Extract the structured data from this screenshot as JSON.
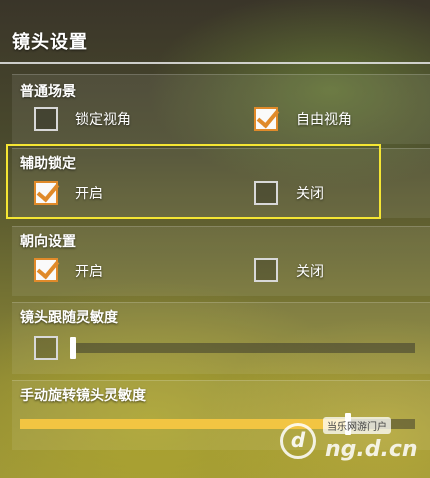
{
  "header": {
    "title": "镜头设置"
  },
  "sections": {
    "normal_scene": {
      "label": "普通场景",
      "options": [
        {
          "label": "锁定视角",
          "checked": false
        },
        {
          "label": "自由视角",
          "checked": true
        }
      ]
    },
    "assist_lock": {
      "label": "辅助锁定",
      "options": [
        {
          "label": "开启",
          "checked": true
        },
        {
          "label": "关闭",
          "checked": false
        }
      ]
    },
    "orientation": {
      "label": "朝向设置",
      "options": [
        {
          "label": "开启",
          "checked": true
        },
        {
          "label": "关闭",
          "checked": false
        }
      ]
    },
    "follow_sensitivity": {
      "label": "镜头跟随灵敏度",
      "enabled": false,
      "value": 0.0
    },
    "manual_rotate_sensitivity": {
      "label": "手动旋转镜头灵敏度",
      "value": 0.83
    }
  },
  "colors": {
    "accent": "#e08a2a",
    "highlight_border": "#f5e633",
    "slider_fill": "#f2c542"
  },
  "watermark": {
    "badge": "当乐网游门户",
    "site": "ng.d.cn",
    "logo": "d"
  }
}
